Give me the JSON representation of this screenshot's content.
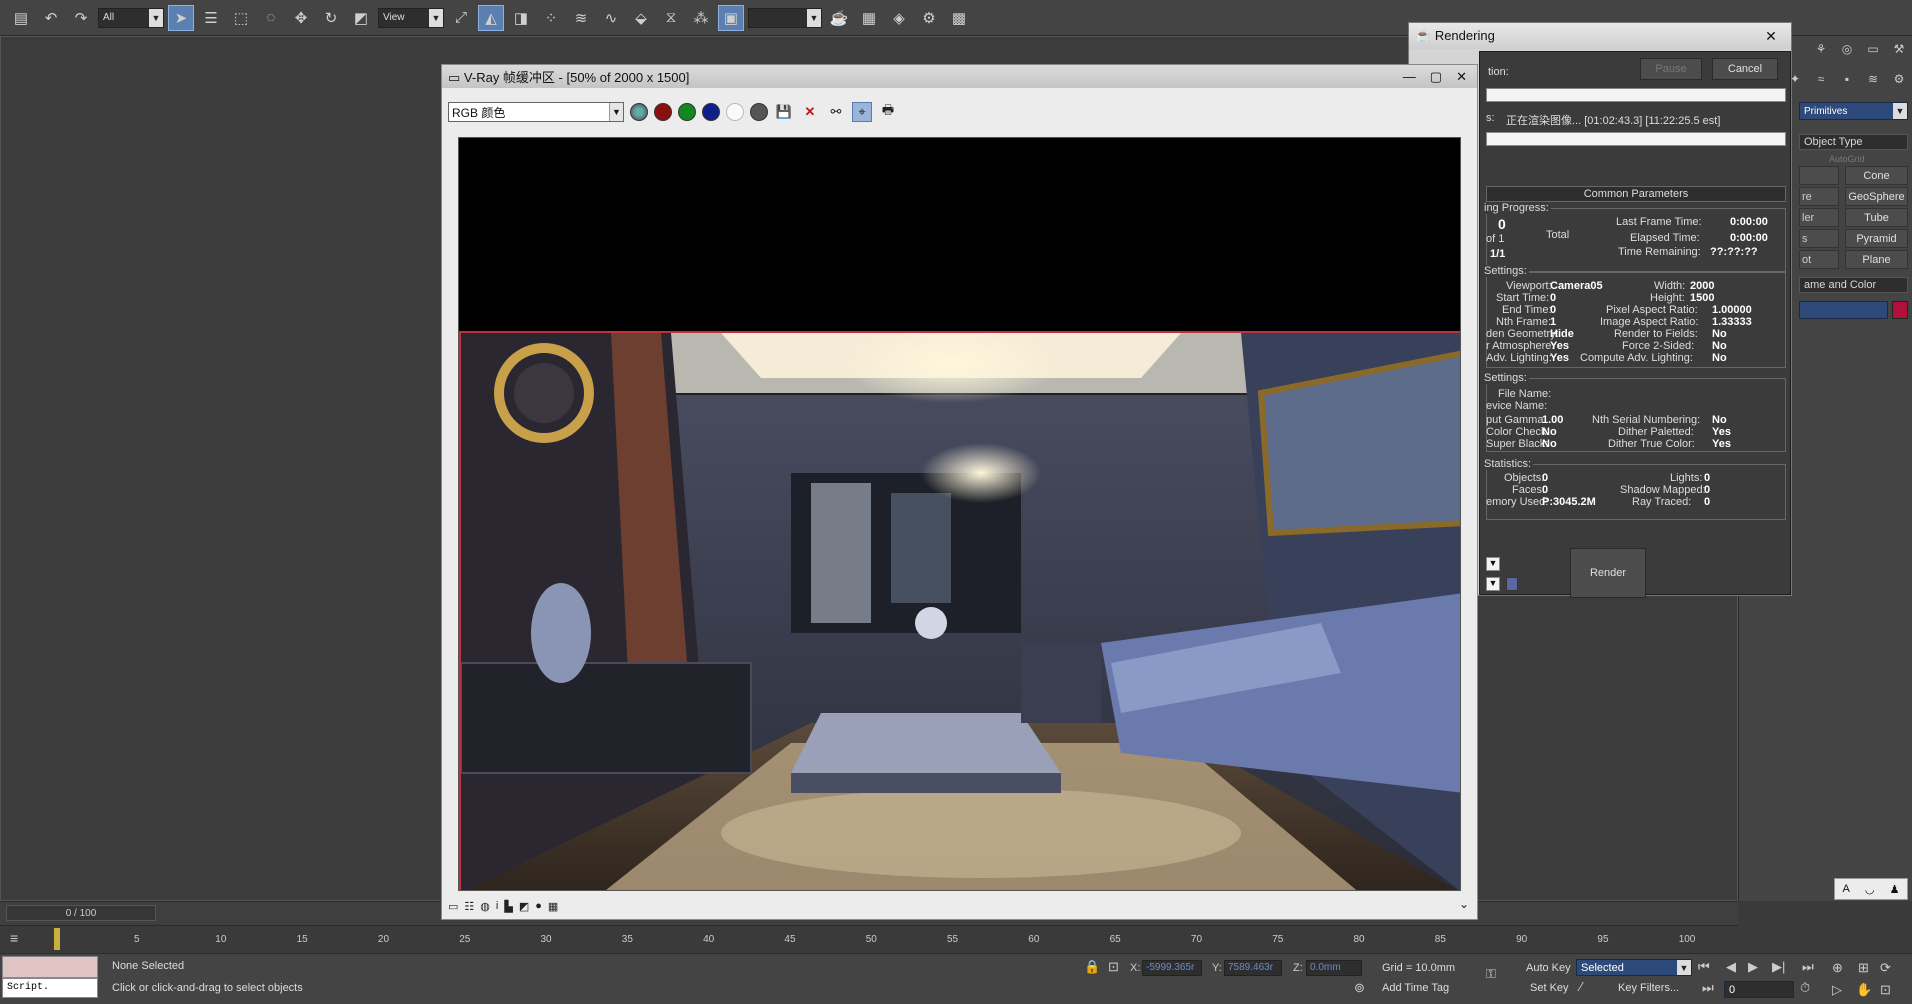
{
  "toolbar": {
    "filter_select": "All",
    "refcoord_select": "View",
    "named_sel_select": ""
  },
  "command_panel": {
    "category": "Primitives",
    "rollout_object_type": "Object Type",
    "autogrid": "AutoGrid",
    "primitives": [
      {
        "left": "",
        "right": "Cone"
      },
      {
        "left": "re",
        "right": "GeoSphere"
      },
      {
        "left": "ler",
        "right": "Tube"
      },
      {
        "left": "s",
        "right": "Pyramid"
      },
      {
        "left": "ot",
        "right": "Plane"
      }
    ],
    "rollout_name_color": "ame and Color",
    "name_value": ""
  },
  "rendering_dialog": {
    "title": "Rendering",
    "pause_label": "Pause",
    "cancel_label": "Cancel",
    "operation_label": "tion:",
    "progress_label": "s:",
    "progress_text": "正在渲染图像... [01:02:43.3] [11:22:25.5 est]",
    "common_parameters": "Common Parameters",
    "render_progress": {
      "header": "ing Progress:",
      "frame_value": "0",
      "of_label": "of 1",
      "total_label": "Total",
      "pass_label": "1/1",
      "last_frame_time_label": "Last Frame Time:",
      "last_frame_time": "0:00:00",
      "elapsed_time_label": "Elapsed Time:",
      "elapsed_time": "0:00:00",
      "time_remaining_label": "Time Remaining:",
      "time_remaining": "??:??:??"
    },
    "render_settings": {
      "header": "Settings:",
      "viewport_label": "Viewport:",
      "viewport": "Camera05",
      "start_time_label": "Start Time:",
      "start_time": "0",
      "end_time_label": "End Time:",
      "end_time": "0",
      "nth_frame_label": "Nth Frame:",
      "nth_frame": "1",
      "hidden_geometry_label": "den Geometry:",
      "hidden_geometry": "Hide",
      "atmosphere_label": "r Atmosphere:",
      "atmosphere": "Yes",
      "adv_lighting_label": "Adv. Lighting:",
      "adv_lighting": "Yes",
      "width_label": "Width:",
      "width": "2000",
      "height_label": "Height:",
      "height": "1500",
      "pixel_aspect_label": "Pixel Aspect Ratio:",
      "pixel_aspect": "1.00000",
      "image_aspect_label": "Image Aspect Ratio:",
      "image_aspect": "1.33333",
      "render_to_fields_label": "Render to Fields:",
      "render_to_fields": "No",
      "force_2sided_label": "Force 2-Sided:",
      "force_2sided": "No",
      "compute_adv_label": "Compute Adv. Lighting:",
      "compute_adv": "No"
    },
    "output_settings": {
      "header": "Settings:",
      "file_name_label": "File Name:",
      "device_name_label": "evice Name:",
      "output_gamma_label": "put Gamma:",
      "output_gamma": "1.00",
      "color_check_label": "Color Check:",
      "color_check": "No",
      "super_black_label": "Super Black:",
      "super_black": "No",
      "nth_serial_label": "Nth Serial Numbering:",
      "nth_serial": "No",
      "dither_paletted_label": "Dither Paletted:",
      "dither_paletted": "Yes",
      "dither_true_label": "Dither True Color:",
      "dither_true": "Yes"
    },
    "statistics": {
      "header": "Statistics:",
      "objects_label": "Objects:",
      "objects": "0",
      "faces_label": "Faces:",
      "faces": "0",
      "memory_label": "emory Used:",
      "memory": "P:3045.2M",
      "lights_label": "Lights:",
      "lights": "0",
      "shadow_mapped_label": "Shadow Mapped:",
      "shadow_mapped": "0",
      "ray_traced_label": "Ray Traced:",
      "ray_traced": "0"
    },
    "render_button": "Render"
  },
  "vfb": {
    "title": "V-Ray 帧缓冲区 - [50% of 2000 x 1500]",
    "channel": "RGB 颜色"
  },
  "timeline": {
    "slider_text": "0 / 100",
    "ticks": [
      "5",
      "10",
      "15",
      "20",
      "25",
      "30",
      "35",
      "40",
      "45",
      "50",
      "55",
      "60",
      "65",
      "70",
      "75",
      "80",
      "85",
      "90",
      "95",
      "100"
    ]
  },
  "status": {
    "maxscript": "Script.",
    "selection": "None Selected",
    "prompt": "Click or click-and-drag to select objects",
    "x_label": "X:",
    "x_value": "-5999.365r",
    "y_label": "Y:",
    "y_value": "7589.463r",
    "z_label": "Z:",
    "z_value": "0.0mm",
    "grid": "Grid = 10.0mm",
    "add_time_tag": "Add Time Tag",
    "auto_key": "Auto Key",
    "set_key": "Set Key",
    "key_mode": "Selected",
    "key_filters": "Key Filters...",
    "frame_value": "0"
  },
  "colors": {
    "accent_blue": "#2d4a7a",
    "render_region_border": "#c0303a",
    "swatch": "#b0103a"
  }
}
